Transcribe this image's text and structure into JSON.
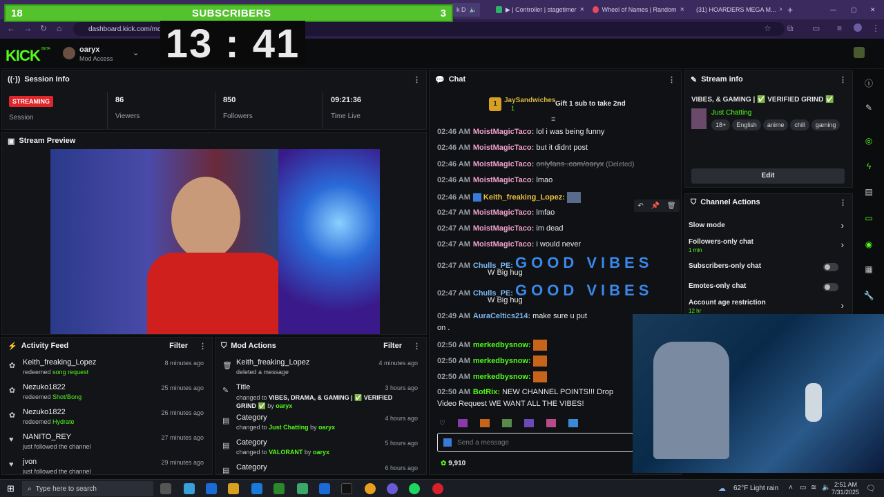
{
  "browser": {
    "tabs": [
      {
        "label": "▶ | Controller | stagetimer",
        "close": "×"
      },
      {
        "label": "Wheel of Names | Random",
        "close": "×"
      },
      {
        "label": "(31) HOARDERS MEGA M...",
        "close": "×"
      }
    ],
    "partial_tab": "k D",
    "new_tab": "+",
    "url": "dashboard.kick.com/mod",
    "window_controls": [
      "—",
      "▢",
      "✕"
    ]
  },
  "overlay": {
    "subs_left": "18",
    "subs_title": "SUBSCRIBERS",
    "subs_right": "3",
    "clock": "13 : 41"
  },
  "header": {
    "logo": "KICK",
    "logo_tag": "BETA",
    "username": "oaryx",
    "role": "Mod Access"
  },
  "session": {
    "title": "Session Info",
    "status": "STREAMING",
    "status_label": "Session",
    "viewers": "86",
    "viewers_label": "Viewers",
    "followers": "850",
    "followers_label": "Followers",
    "time_live": "09:21:36",
    "time_label": "Time Live"
  },
  "preview": {
    "title": "Stream Preview"
  },
  "activity": {
    "title": "Activity Feed",
    "filter": "Filter",
    "items": [
      {
        "name": "Keith_freaking_Lopez",
        "action": "redeemed",
        "detail": "song request",
        "time": "8 minutes ago"
      },
      {
        "name": "Nezuko1822",
        "action": "redeemed",
        "detail": "Shot/Bong",
        "time": "25 minutes ago"
      },
      {
        "name": "Nezuko1822",
        "action": "redeemed",
        "detail": "Hydrate",
        "time": "26 minutes ago"
      },
      {
        "name": "NANITO_REY",
        "action": "just followed the channel",
        "detail": "",
        "time": "27 minutes ago"
      },
      {
        "name": "jvon",
        "action": "just followed the channel",
        "detail": "",
        "time": "29 minutes ago"
      }
    ]
  },
  "mod": {
    "title": "Mod Actions",
    "filter": "Filter",
    "items": [
      {
        "name": "Keith_freaking_Lopez",
        "sub": "deleted a message",
        "time": "4 minutes ago"
      },
      {
        "name": "Title",
        "sub_pre": "changed to",
        "sub_val": "VIBES, DRAMA, & GAMING | ✅ VERIFIED GRIND ✅",
        "by": "by",
        "who": "oaryx",
        "time": "3 hours ago"
      },
      {
        "name": "Category",
        "sub_pre": "changed to",
        "sub_val": "Just Chatting",
        "by": "by",
        "who": "oaryx",
        "time": "4 hours ago"
      },
      {
        "name": "Category",
        "sub_pre": "changed to",
        "sub_val": "VALORANT",
        "by": "by",
        "who": "oaryx",
        "time": "5 hours ago"
      },
      {
        "name": "Category",
        "time": "6 hours ago"
      }
    ]
  },
  "chat": {
    "title": "Chat",
    "pinned_user": "JaySandwiches",
    "pinned_count": "1",
    "pinned_msg": "Gift 1 sub to take 2nd",
    "lines": [
      {
        "t": "02:46 AM",
        "u": "MoistMagicTaco:",
        "m": "lol i was being funny"
      },
      {
        "t": "02:46 AM",
        "u": "MoistMagicTaco:",
        "m": "but it didnt post"
      },
      {
        "t": "02:46 AM",
        "u": "MoistMagicTaco:",
        "m": "onlyfans .com/oaryx",
        "note": "(Deleted)"
      },
      {
        "t": "02:46 AM",
        "u": "MoistMagicTaco:",
        "m": "lmao"
      },
      {
        "t": "02:46 AM",
        "u": "Keith_freaking_Lopez:",
        "m": ""
      },
      {
        "t": "02:47 AM",
        "u": "MoistMagicTaco:",
        "m": "lmfao"
      },
      {
        "t": "02:47 AM",
        "u": "MoistMagicTaco:",
        "m": "im dead"
      },
      {
        "t": "02:47 AM",
        "u": "MoistMagicTaco:",
        "m": "i would never"
      },
      {
        "t": "02:47 AM",
        "u": "Chulls_PE:",
        "m": "GOOD VIBES",
        "m2": "W Big hug"
      },
      {
        "t": "02:47 AM",
        "u": "Chulls_PE:",
        "m": "GOOD VIBES",
        "m2": "W Big hug"
      },
      {
        "t": "02:49 AM",
        "u": "AuraCeltics214:",
        "m": "make sure u put",
        "m2": "on ."
      },
      {
        "t": "02:50 AM",
        "u": "merkedbysnow:",
        "m": ""
      },
      {
        "t": "02:50 AM",
        "u": "merkedbysnow:",
        "m": ""
      },
      {
        "t": "02:50 AM",
        "u": "merkedbysnow:",
        "m": ""
      },
      {
        "t": "02:50 AM",
        "u": "BotRix:",
        "m": "NEW CHANNEL POINTS!!! Drop",
        "m2": "Video Request WE WANT ALL THE VIBES!"
      }
    ],
    "input_placeholder": "Send a message",
    "points": "9,910"
  },
  "stream_info": {
    "title": "Stream info",
    "stream_title": "VIBES, & GAMING | ✅ VERIFIED GRIND ✅",
    "category": "Just Chatting",
    "tags": [
      "18+",
      "English",
      "anime",
      "chill",
      "gaming"
    ],
    "edit": "Edit"
  },
  "channel_actions": {
    "title": "Channel Actions",
    "slow": "Slow mode",
    "followers_only": "Followers-only chat",
    "followers_min": "1 min",
    "subs_only": "Subscribers-only chat",
    "emotes_only": "Emotes-only chat",
    "age": "Account age restriction",
    "age_val": "12 hr"
  },
  "taskbar": {
    "search": "Type here to search",
    "weather": "62°F  Light rain",
    "time": "2:51 AM",
    "date": "7/31/2025"
  },
  "colors": {
    "kick_green": "#53fc18",
    "live_red": "#e0252b",
    "overlay_green": "#53c22d"
  }
}
